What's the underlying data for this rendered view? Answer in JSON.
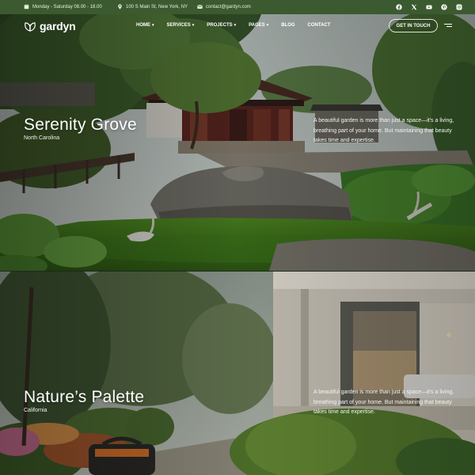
{
  "topbar": {
    "hours": "Monday - Saturday 08.00 - 18.00",
    "address": "100 S Main St, New York, NY",
    "email": "contact@gardyn.com",
    "socials": [
      "facebook-icon",
      "x-icon",
      "youtube-icon",
      "pinterest-icon",
      "instagram-icon"
    ]
  },
  "nav": {
    "logo": "gardyn",
    "items": [
      {
        "label": "HOME",
        "dropdown": true
      },
      {
        "label": "SERVICES",
        "dropdown": true
      },
      {
        "label": "PROJECTS",
        "dropdown": true
      },
      {
        "label": "PAGES",
        "dropdown": true
      },
      {
        "label": "BLOG",
        "dropdown": false
      },
      {
        "label": "CONTACT",
        "dropdown": false
      }
    ],
    "cta": "GET IN TOUCH"
  },
  "projects": [
    {
      "title": "Serenity Grove",
      "location": "North Carolina",
      "description": "A beautiful garden is more than just a space—it's a living, breathing part of your home. But maintaining that beauty takes time and expertise."
    },
    {
      "title": "Nature’s Palette",
      "location": "California",
      "description": "A beautiful garden is more than just a space—it's a living, breathing part of your home. But maintaining that beauty takes time and expertise."
    }
  ],
  "colors": {
    "topbar": "#3b5a2f",
    "text": "#ffffff"
  }
}
